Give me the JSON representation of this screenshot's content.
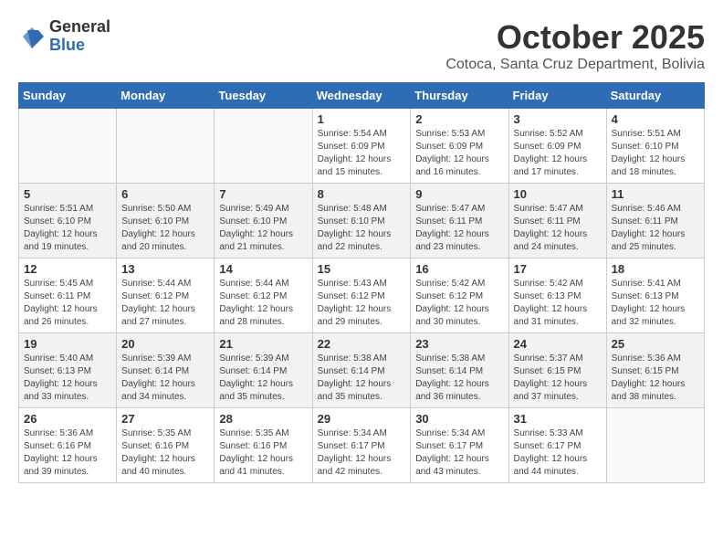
{
  "header": {
    "logo_general": "General",
    "logo_blue": "Blue",
    "month_title": "October 2025",
    "location": "Cotoca, Santa Cruz Department, Bolivia"
  },
  "days_of_week": [
    "Sunday",
    "Monday",
    "Tuesday",
    "Wednesday",
    "Thursday",
    "Friday",
    "Saturday"
  ],
  "weeks": [
    {
      "days": [
        {
          "num": "",
          "info": ""
        },
        {
          "num": "",
          "info": ""
        },
        {
          "num": "",
          "info": ""
        },
        {
          "num": "1",
          "info": "Sunrise: 5:54 AM\nSunset: 6:09 PM\nDaylight: 12 hours\nand 15 minutes."
        },
        {
          "num": "2",
          "info": "Sunrise: 5:53 AM\nSunset: 6:09 PM\nDaylight: 12 hours\nand 16 minutes."
        },
        {
          "num": "3",
          "info": "Sunrise: 5:52 AM\nSunset: 6:09 PM\nDaylight: 12 hours\nand 17 minutes."
        },
        {
          "num": "4",
          "info": "Sunrise: 5:51 AM\nSunset: 6:10 PM\nDaylight: 12 hours\nand 18 minutes."
        }
      ]
    },
    {
      "days": [
        {
          "num": "5",
          "info": "Sunrise: 5:51 AM\nSunset: 6:10 PM\nDaylight: 12 hours\nand 19 minutes."
        },
        {
          "num": "6",
          "info": "Sunrise: 5:50 AM\nSunset: 6:10 PM\nDaylight: 12 hours\nand 20 minutes."
        },
        {
          "num": "7",
          "info": "Sunrise: 5:49 AM\nSunset: 6:10 PM\nDaylight: 12 hours\nand 21 minutes."
        },
        {
          "num": "8",
          "info": "Sunrise: 5:48 AM\nSunset: 6:10 PM\nDaylight: 12 hours\nand 22 minutes."
        },
        {
          "num": "9",
          "info": "Sunrise: 5:47 AM\nSunset: 6:11 PM\nDaylight: 12 hours\nand 23 minutes."
        },
        {
          "num": "10",
          "info": "Sunrise: 5:47 AM\nSunset: 6:11 PM\nDaylight: 12 hours\nand 24 minutes."
        },
        {
          "num": "11",
          "info": "Sunrise: 5:46 AM\nSunset: 6:11 PM\nDaylight: 12 hours\nand 25 minutes."
        }
      ]
    },
    {
      "days": [
        {
          "num": "12",
          "info": "Sunrise: 5:45 AM\nSunset: 6:11 PM\nDaylight: 12 hours\nand 26 minutes."
        },
        {
          "num": "13",
          "info": "Sunrise: 5:44 AM\nSunset: 6:12 PM\nDaylight: 12 hours\nand 27 minutes."
        },
        {
          "num": "14",
          "info": "Sunrise: 5:44 AM\nSunset: 6:12 PM\nDaylight: 12 hours\nand 28 minutes."
        },
        {
          "num": "15",
          "info": "Sunrise: 5:43 AM\nSunset: 6:12 PM\nDaylight: 12 hours\nand 29 minutes."
        },
        {
          "num": "16",
          "info": "Sunrise: 5:42 AM\nSunset: 6:12 PM\nDaylight: 12 hours\nand 30 minutes."
        },
        {
          "num": "17",
          "info": "Sunrise: 5:42 AM\nSunset: 6:13 PM\nDaylight: 12 hours\nand 31 minutes."
        },
        {
          "num": "18",
          "info": "Sunrise: 5:41 AM\nSunset: 6:13 PM\nDaylight: 12 hours\nand 32 minutes."
        }
      ]
    },
    {
      "days": [
        {
          "num": "19",
          "info": "Sunrise: 5:40 AM\nSunset: 6:13 PM\nDaylight: 12 hours\nand 33 minutes."
        },
        {
          "num": "20",
          "info": "Sunrise: 5:39 AM\nSunset: 6:14 PM\nDaylight: 12 hours\nand 34 minutes."
        },
        {
          "num": "21",
          "info": "Sunrise: 5:39 AM\nSunset: 6:14 PM\nDaylight: 12 hours\nand 35 minutes."
        },
        {
          "num": "22",
          "info": "Sunrise: 5:38 AM\nSunset: 6:14 PM\nDaylight: 12 hours\nand 35 minutes."
        },
        {
          "num": "23",
          "info": "Sunrise: 5:38 AM\nSunset: 6:14 PM\nDaylight: 12 hours\nand 36 minutes."
        },
        {
          "num": "24",
          "info": "Sunrise: 5:37 AM\nSunset: 6:15 PM\nDaylight: 12 hours\nand 37 minutes."
        },
        {
          "num": "25",
          "info": "Sunrise: 5:36 AM\nSunset: 6:15 PM\nDaylight: 12 hours\nand 38 minutes."
        }
      ]
    },
    {
      "days": [
        {
          "num": "26",
          "info": "Sunrise: 5:36 AM\nSunset: 6:16 PM\nDaylight: 12 hours\nand 39 minutes."
        },
        {
          "num": "27",
          "info": "Sunrise: 5:35 AM\nSunset: 6:16 PM\nDaylight: 12 hours\nand 40 minutes."
        },
        {
          "num": "28",
          "info": "Sunrise: 5:35 AM\nSunset: 6:16 PM\nDaylight: 12 hours\nand 41 minutes."
        },
        {
          "num": "29",
          "info": "Sunrise: 5:34 AM\nSunset: 6:17 PM\nDaylight: 12 hours\nand 42 minutes."
        },
        {
          "num": "30",
          "info": "Sunrise: 5:34 AM\nSunset: 6:17 PM\nDaylight: 12 hours\nand 43 minutes."
        },
        {
          "num": "31",
          "info": "Sunrise: 5:33 AM\nSunset: 6:17 PM\nDaylight: 12 hours\nand 44 minutes."
        },
        {
          "num": "",
          "info": ""
        }
      ]
    }
  ]
}
